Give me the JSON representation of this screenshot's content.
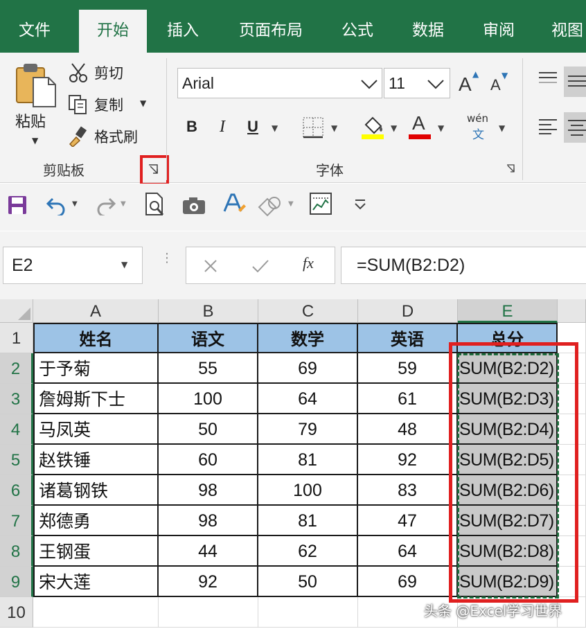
{
  "tabs": [
    {
      "label": "文件",
      "active": false
    },
    {
      "label": "开始",
      "active": true
    },
    {
      "label": "插入",
      "active": false
    },
    {
      "label": "页面布局",
      "active": false
    },
    {
      "label": "公式",
      "active": false
    },
    {
      "label": "数据",
      "active": false
    },
    {
      "label": "审阅",
      "active": false
    },
    {
      "label": "视图",
      "active": false
    }
  ],
  "ribbon": {
    "clipboard": {
      "paste_label": "粘贴",
      "cut_label": "剪切",
      "copy_label": "复制",
      "format_painter_label": "格式刷",
      "group_label": "剪贴板"
    },
    "font": {
      "font_name": "Arial",
      "font_size": "11",
      "bold": "B",
      "italic": "I",
      "underline": "U",
      "font_color_letter": "A",
      "phonetic_top": "wén",
      "phonetic_bottom": "文",
      "grow_letter": "A",
      "shrink_letter": "A",
      "group_label": "字体"
    }
  },
  "formula_bar": {
    "name_box": "E2",
    "fx_label": "fx",
    "formula": "=SUM(B2:D2)"
  },
  "grid": {
    "columns": [
      "A",
      "B",
      "C",
      "D",
      "E"
    ],
    "selected_column": "E",
    "rows": [
      "1",
      "2",
      "3",
      "4",
      "5",
      "6",
      "7",
      "8",
      "9",
      "10"
    ],
    "header": [
      "姓名",
      "语文",
      "数学",
      "英语",
      "总分"
    ],
    "data": [
      {
        "name": "于予菊",
        "b": "55",
        "c": "69",
        "d": "59",
        "e": "SUM(B2:D2)"
      },
      {
        "name": "詹姆斯下士",
        "b": "100",
        "c": "64",
        "d": "61",
        "e": "SUM(B2:D3)"
      },
      {
        "name": "马凤英",
        "b": "50",
        "c": "79",
        "d": "48",
        "e": "SUM(B2:D4)"
      },
      {
        "name": "赵铁锤",
        "b": "60",
        "c": "81",
        "d": "92",
        "e": "SUM(B2:D5)"
      },
      {
        "name": "诸葛钢铁",
        "b": "98",
        "c": "100",
        "d": "83",
        "e": "SUM(B2:D6)"
      },
      {
        "name": "郑德勇",
        "b": "98",
        "c": "81",
        "d": "47",
        "e": "SUM(B2:D7)"
      },
      {
        "name": "王钢蛋",
        "b": "44",
        "c": "62",
        "d": "64",
        "e": "SUM(B2:D8)"
      },
      {
        "name": "宋大莲",
        "b": "92",
        "c": "50",
        "d": "69",
        "e": "SUM(B2:D9)"
      }
    ]
  },
  "watermark": "头条 @Excel学习世界",
  "colors": {
    "excel_green": "#217346",
    "header_fill": "#9dc3e6",
    "highlight_red": "#e02020",
    "marching_ants": "#1e6b3c"
  }
}
